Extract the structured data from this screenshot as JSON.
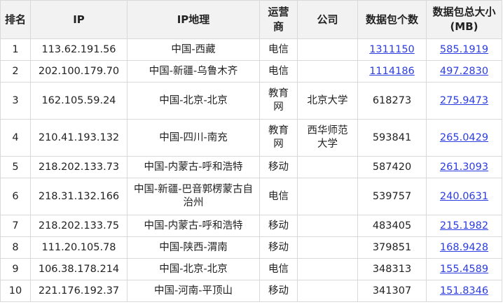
{
  "headers": {
    "rank": "排名",
    "ip": "IP",
    "region": "IP地理",
    "carrier": "运营商",
    "company": "公司",
    "count": "数据包个数",
    "size": "数据包总大小(MB)"
  },
  "rows": [
    {
      "rank": "1",
      "ip": "113.62.191.56",
      "region": "中国-西藏",
      "carrier": "电信",
      "company": "",
      "count": "1311150",
      "size": "585.1919"
    },
    {
      "rank": "2",
      "ip": "202.100.179.70",
      "region": "中国-新疆-乌鲁木齐",
      "carrier": "电信",
      "company": "",
      "count": "1114186",
      "size": "497.2830"
    },
    {
      "rank": "3",
      "ip": "162.105.59.24",
      "region": "中国-北京-北京",
      "carrier": "教育网",
      "company": "北京大学",
      "count": "618273",
      "size": "275.9473"
    },
    {
      "rank": "4",
      "ip": "210.41.193.132",
      "region": "中国-四川-南充",
      "carrier": "教育网",
      "company": "西华师范大学",
      "count": "593841",
      "size": "265.0429"
    },
    {
      "rank": "5",
      "ip": "218.202.133.73",
      "region": "中国-内蒙古-呼和浩特",
      "carrier": "移动",
      "company": "",
      "count": "587420",
      "size": "261.3093"
    },
    {
      "rank": "6",
      "ip": "218.31.132.166",
      "region": "中国-新疆-巴音郭楞蒙古自治州",
      "carrier": "电信",
      "company": "",
      "count": "539757",
      "size": "240.0631"
    },
    {
      "rank": "7",
      "ip": "218.202.133.75",
      "region": "中国-内蒙古-呼和浩特",
      "carrier": "移动",
      "company": "",
      "count": "483405",
      "size": "215.1982"
    },
    {
      "rank": "8",
      "ip": "111.20.105.78",
      "region": "中国-陕西-渭南",
      "carrier": "移动",
      "company": "",
      "count": "379851",
      "size": "168.9428"
    },
    {
      "rank": "9",
      "ip": "106.38.178.214",
      "region": "中国-北京-北京",
      "carrier": "电信",
      "company": "",
      "count": "348313",
      "size": "155.4589"
    },
    {
      "rank": "10",
      "ip": "221.176.192.37",
      "region": "中国-河南-平顶山",
      "carrier": "移动",
      "company": "",
      "count": "341307",
      "size": "151.8346"
    }
  ]
}
